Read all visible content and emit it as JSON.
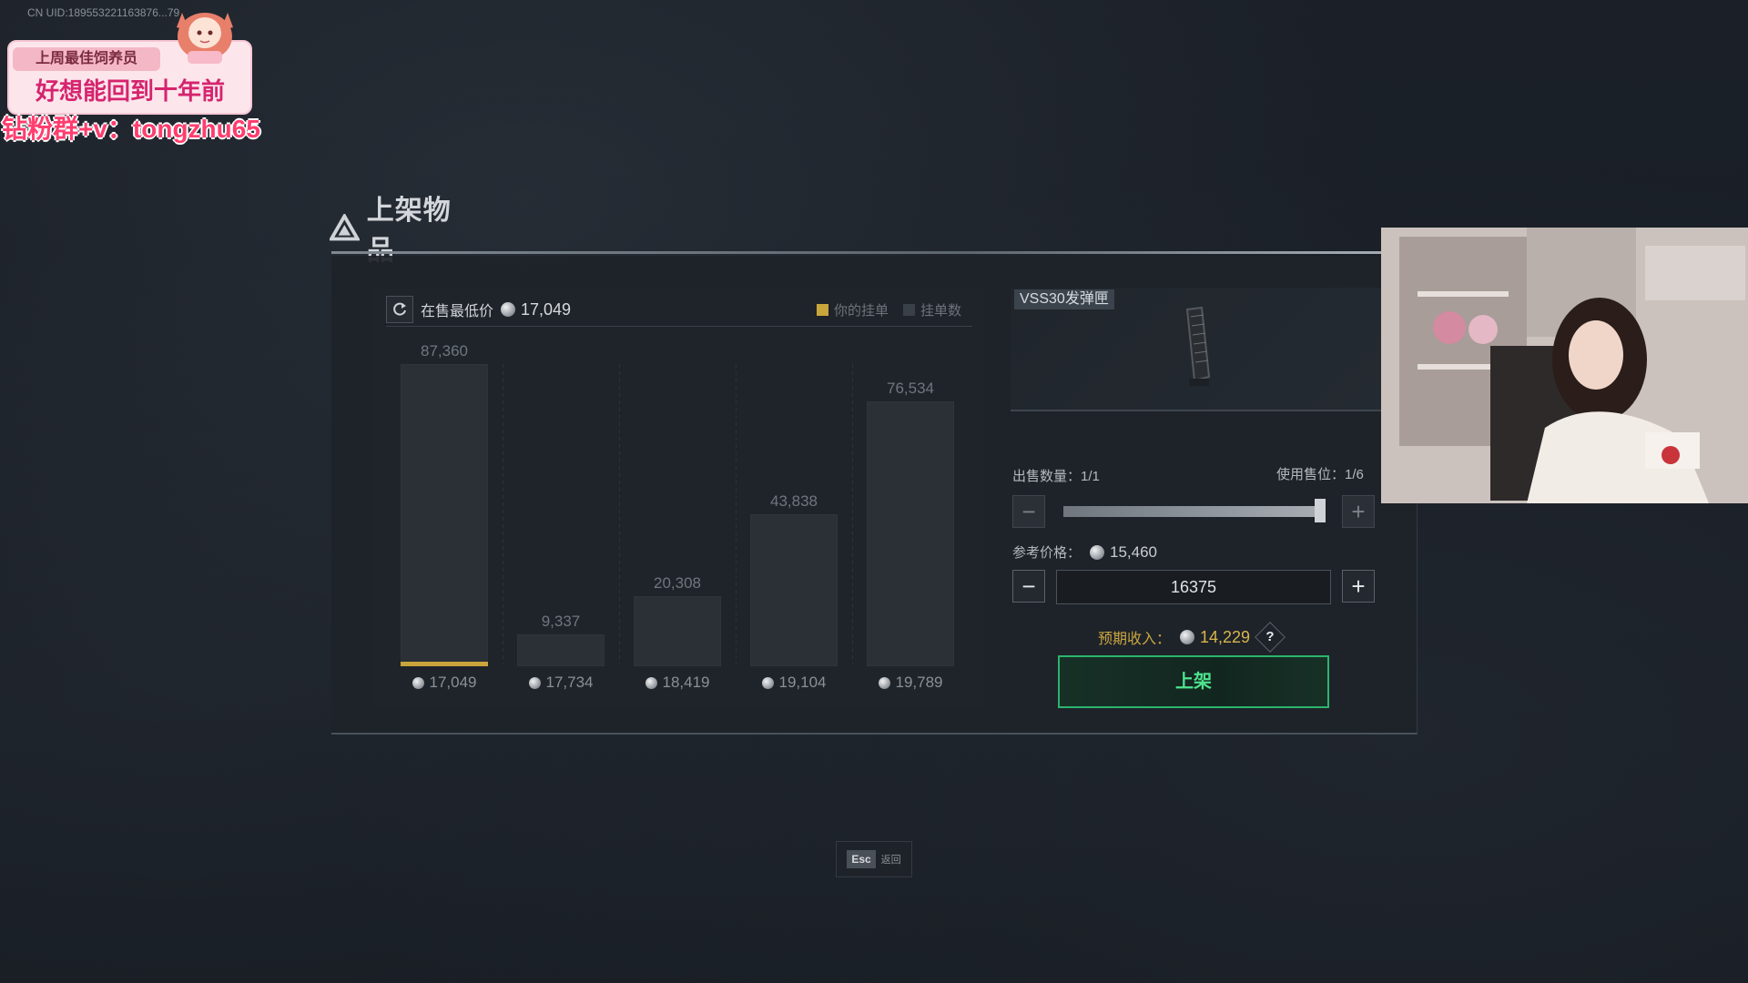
{
  "overlay": {
    "uid_text": "CN UID:189553221163876...79",
    "promo_tag": "上周最佳饲养员",
    "promo_main": "好想能回到十年前",
    "promo_contact": "钻粉群+v：tongzhu65"
  },
  "dialog": {
    "title": "上架物品"
  },
  "chart_header": {
    "lowest_label": "在售最低价",
    "lowest_value": "17,049",
    "legend": [
      {
        "label": "你的挂单",
        "color": "#c9a63b"
      },
      {
        "label": "挂单数",
        "color": "#3a4047"
      }
    ]
  },
  "chart_data": {
    "type": "bar",
    "categories": [
      "17,049",
      "17,734",
      "18,419",
      "19,104",
      "19,789"
    ],
    "values": [
      87360,
      9337,
      20308,
      43838,
      76534
    ],
    "value_labels": [
      "87,360",
      "9,337",
      "20,308",
      "43,838",
      "76,534"
    ],
    "your_listing_category": "17,049",
    "ylim": [
      0,
      87360
    ]
  },
  "item": {
    "name": "VSS30发弹匣"
  },
  "sell": {
    "qty_label": "出售数量：1/1",
    "slot_label": "使用售位：1/6",
    "qty_fraction": 1.0,
    "ref_label": "参考价格：",
    "ref_value": "15,460",
    "price_input": "16375",
    "income_label": "预期收入：",
    "income_value": "14,229",
    "help_symbol": "?",
    "list_button": "上架",
    "minus_symbol": "−",
    "plus_symbol": "+"
  },
  "footer": {
    "esc_key": "Esc",
    "esc_text": "返回"
  },
  "colors": {
    "accent_green": "#2bb56d",
    "accent_gold": "#c9a63b"
  }
}
